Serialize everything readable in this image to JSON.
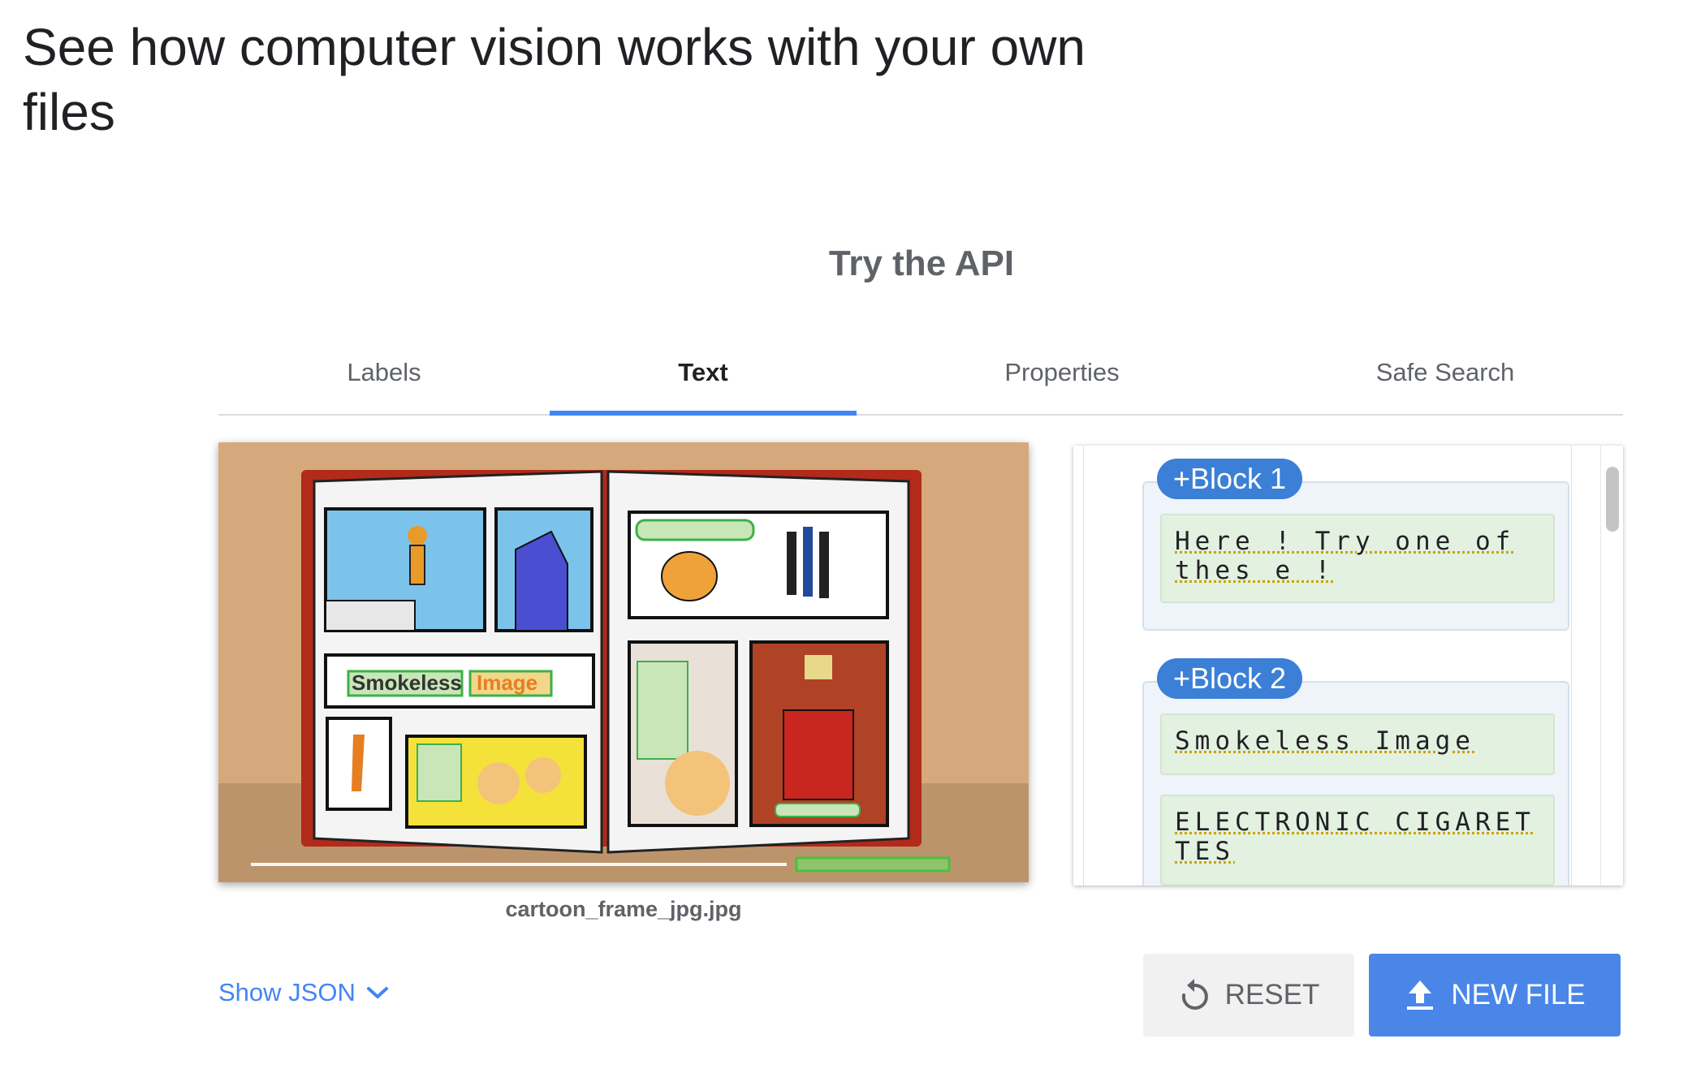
{
  "page": {
    "title": "See how computer vision works with your own files",
    "section_title": "Try the API"
  },
  "tabs": [
    {
      "label": "Labels",
      "active": false
    },
    {
      "label": "Text",
      "active": true
    },
    {
      "label": "Properties",
      "active": false
    },
    {
      "label": "Safe Search",
      "active": false
    }
  ],
  "image": {
    "file_name": "cartoon_frame_jpg.jpg",
    "overlay_texts": [
      "Smokeless",
      "Image"
    ]
  },
  "results": {
    "blocks": [
      {
        "label": "+Block 1",
        "items": [
          "Here ! Try one of thes e !"
        ]
      },
      {
        "label": "+Block 2",
        "items": [
          "Smokeless Image",
          "ELECTRONIC CIGARET TES"
        ]
      }
    ]
  },
  "actions": {
    "show_json": "Show JSON",
    "reset": "RESET",
    "new_file": "NEW FILE"
  },
  "colors": {
    "accent": "#4285f4",
    "block_badge": "#3c7fd6",
    "new_file_button": "#4a86e8",
    "text_item_bg": "#e3f1e1",
    "block_bg": "#eef4fa"
  }
}
